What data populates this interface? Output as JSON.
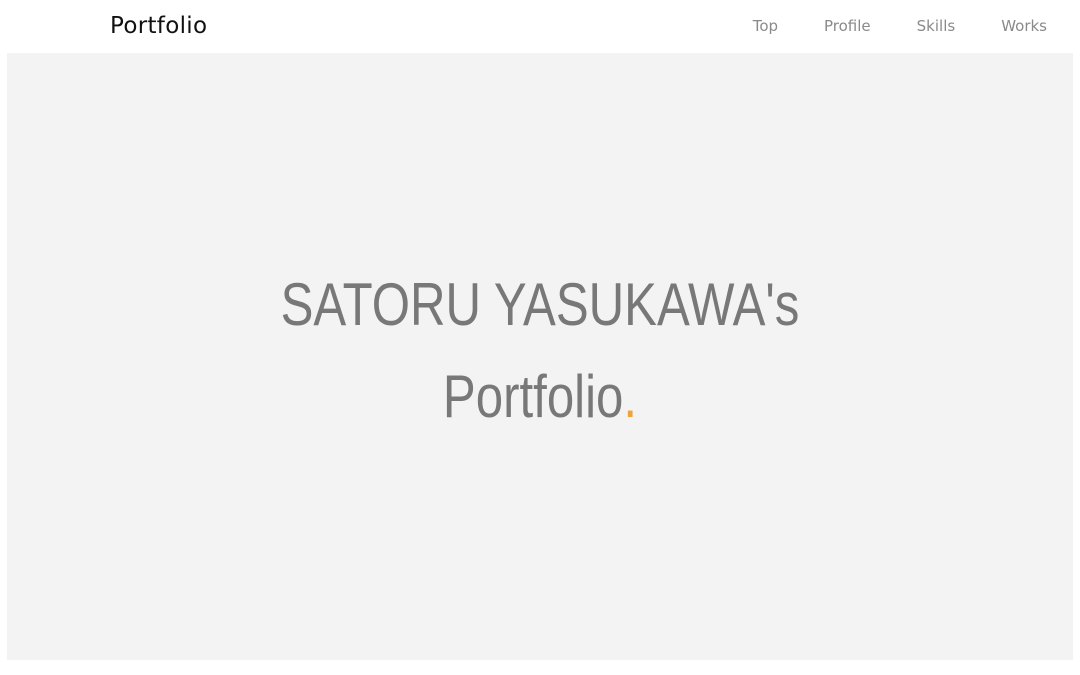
{
  "header": {
    "logo": "Portfolio",
    "nav": [
      {
        "label": "Top"
      },
      {
        "label": "Profile"
      },
      {
        "label": "Skills"
      },
      {
        "label": "Works"
      }
    ]
  },
  "hero": {
    "line1": "SATORU YASUKAWA's",
    "line2": "Portfolio",
    "accent_dot": ".",
    "accent_color": "#f0a33a",
    "background_color": "#f3f3f3"
  }
}
